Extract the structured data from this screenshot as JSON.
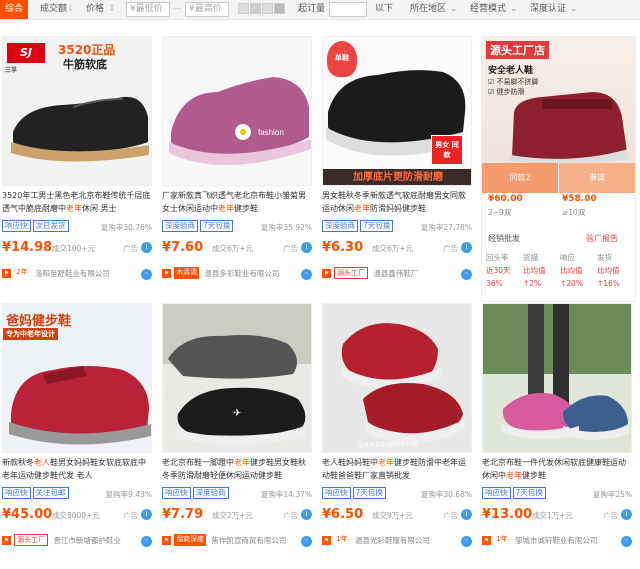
{
  "toolbar": {
    "sort_general": "综合",
    "sort_volume": "成交额",
    "sort_price": "价格",
    "price_min_placeholder": "¥最低价",
    "price_max_placeholder": "¥最高价",
    "price_dash": "—",
    "min_order": "起订量",
    "min_order_suffix": "以下",
    "region": "所在地区",
    "business_mode": "经营模式",
    "depth_cert": "深度认证"
  },
  "products": [
    {
      "img_text1": "3520正品",
      "img_text2": "牛筋软底",
      "img_brand": "三孚",
      "title_pre": "3520年工男士黑色老北京布鞋传统千层底透气中脆底耐磨中",
      "title_hl": "老年",
      "title_post": "休闲 男士",
      "tags": [
        "响应快",
        "次日发货"
      ],
      "rate": "复购率30.76%",
      "price": "¥14.98",
      "deal": "成交100+元",
      "ad": "广告",
      "seller_badge": "2年",
      "seller": "洛阳至舒鞋业有限公司"
    },
    {
      "title_pre": "厂家新款真飞织透气老北京布鞋小雏菊男女士休闲运动中",
      "title_hl": "老年",
      "title_post": "健步鞋",
      "tags": [
        "深度验商",
        "7天包换"
      ],
      "rate": "复购率35.92%",
      "price": "¥7.60",
      "deal": "成交6万+元",
      "ad": "广告",
      "seller_badge": "木清清 ",
      "seller": "温县多彩鞋业有限公司"
    },
    {
      "img_text1": "单鞋",
      "img_text2": "男女 同款",
      "img_banner": "加厚底片更防滑耐磨",
      "title_pre": "男女鞋秋冬季新款透气软底耐磨男女同款运动休闲",
      "title_hl": "老年",
      "title_post": "防滑妈妈健步鞋",
      "tags": [
        "深度验商",
        "7天包换"
      ],
      "rate": "复购率27.78%",
      "price": "¥6.30",
      "deal": "成交6万+元",
      "ad": "广告",
      "seller_badge": "源头工厂",
      "seller": "温县鑫伟鞋厂"
    },
    {
      "title_pre": "新款秋冬",
      "title_hl": "老人",
      "title_post": "鞋男女妈妈鞋女软底软底中老年运动健步鞋代发 老人",
      "tags": [
        "响应快",
        "关注包邮"
      ],
      "rate": "复购率9.43%",
      "price": "¥45.00",
      "deal": "成交8000+元",
      "ad": "广告",
      "seller_badge": "源头工厂",
      "seller": "晋江市新塘都护鞋业",
      "img_text1": "爸妈健步鞋",
      "img_text2": "专为中老年设计"
    },
    {
      "title_pre": "老北京布鞋一脚蹬中",
      "title_hl": "老年",
      "title_post": "健步鞋男女鞋秋冬季防滑耐磨轻便休闲运动健步鞋",
      "tags": [
        "响应快",
        "深度验商"
      ],
      "rate": "复购率14.37%",
      "price": "¥7.79",
      "deal": "成交2万+元",
      "ad": "广告",
      "seller_badge": "溜商深度",
      "seller": "焦作凯宣商贸有限公司"
    },
    {
      "title_pre": "老人鞋妈妈鞋中",
      "title_hl": "老年",
      "title_post": "健步鞋防滑中老年运动鞋爸爸鞋厂家直销批发",
      "tags": [
        "响应快",
        "7天包换"
      ],
      "rate": "复购率30.68%",
      "price": "¥6.50",
      "deal": "成交9万+元",
      "ad": "广告",
      "seller_badge": "1年",
      "seller": "温县光彩鞋服有限公司",
      "img_watermark": "温县光彩鞋服有限公司"
    },
    {
      "title_pre": "老北京布鞋一件代发休闲软底健康鞋运动休闲中",
      "title_hl": "老年",
      "title_post": "健步鞋",
      "tags": [
        "响应快",
        "7天包换"
      ],
      "rate": "复购率25%",
      "price": "¥13.00",
      "deal": "成交1万+元",
      "ad": "广告",
      "seller_badge": "1年",
      "seller": "邹城市诚轩鞋业有限公司"
    }
  ],
  "ad_card": {
    "banner_title": "源头工厂店",
    "banner_sub": "安全老人鞋",
    "features": [
      "☑ 不易脚不挤脚",
      "☑ 健步防滑"
    ],
    "sub_left": "同款2",
    "sub_right": "参谋",
    "price_left": "¥60.00",
    "qty_left": "2~9双",
    "price_right": "¥58.00",
    "qty_right": "≥10双",
    "batch_label": "经销批发",
    "report": "验厂报告",
    "stat_headers": [
      "回头率",
      "货描",
      "响应",
      "发货"
    ],
    "stat_row2": [
      "近30天",
      "比均值",
      "比均值",
      "比均值"
    ],
    "stat_row3": [
      "36%",
      "↑2%",
      "↑20%",
      "↑16%"
    ]
  },
  "colors": {
    "accent": "#ff5000",
    "link_blue": "#3c78d8"
  }
}
